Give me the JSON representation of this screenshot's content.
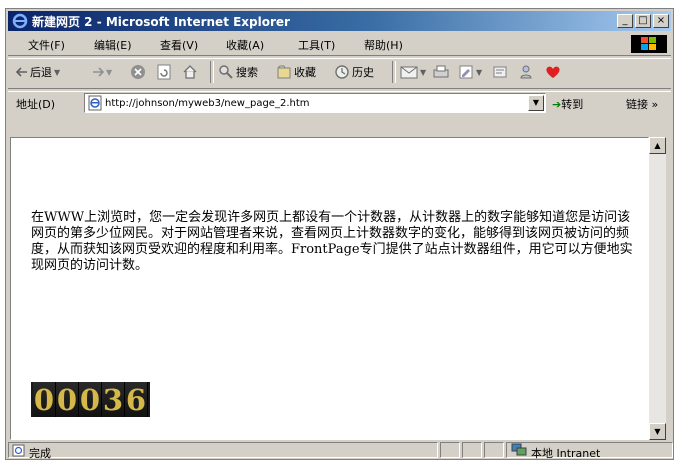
{
  "window": {
    "title": "新建网页 2 - Microsoft Internet Explorer",
    "controls": {
      "minimize": "_",
      "maximize": "□",
      "close": "×"
    }
  },
  "menu": [
    "文件(F)",
    "编辑(E)",
    "查看(V)",
    "收藏(A)",
    "工具(T)",
    "帮助(H)"
  ],
  "toolbar": {
    "back": "后退",
    "search": "搜索",
    "favorites": "收藏",
    "history": "历史"
  },
  "address": {
    "label": "地址(D)",
    "url": "http://johnson/myweb3/new_page_2.htm",
    "go": "转到",
    "links": "链接 »"
  },
  "page": {
    "paragraph": "在WWW上浏览时，您一定会发现许多网页上都设有一个计数器，从计数器上的数字能够知道您是访问该网页的第多少位网民。对于网站管理者来说，查看网页上计数器数字的变化，能够得到该网页被访问的频度，从而获知该网页受欢迎的程度和利用率。FrontPage专门提供了站点计数器组件，用它可以方便地实现网页的访问计数。",
    "counter_digits": [
      "0",
      "0",
      "0",
      "3",
      "6"
    ]
  },
  "status": {
    "left": "完成",
    "zone": "本地 Intranet"
  },
  "colors": {
    "title_start": "#0a246a",
    "title_end": "#a6caf0",
    "chrome": "#d4d0c8",
    "counter_digit": "#d4b84a"
  }
}
